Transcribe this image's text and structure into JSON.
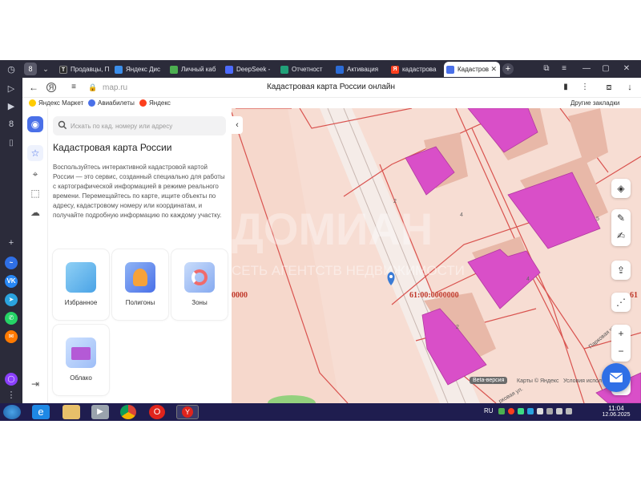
{
  "browser": {
    "tabs": [
      {
        "label": "Продавцы, П",
        "favicon": "T",
        "color": "#2b2b2b"
      },
      {
        "label": "Яндекс Дис",
        "favicon": "",
        "color": "#3b8eea"
      },
      {
        "label": "Личный каб",
        "favicon": "",
        "color": "#4caf50"
      },
      {
        "label": "DeepSeek -",
        "favicon": "",
        "color": "#4d6bfe"
      },
      {
        "label": "Отчетност",
        "favicon": "",
        "color": "#21a179"
      },
      {
        "label": "Активация",
        "favicon": "",
        "color": "#2c6cd6"
      },
      {
        "label": "кадастрова",
        "favicon": "Я",
        "color": "#fc3f1d"
      },
      {
        "label": "Кадастров",
        "favicon": "",
        "color": "#4a70e8",
        "active": true
      }
    ],
    "tab_count_badge": "8",
    "url": "map.ru",
    "page_title": "Кадастровая карта России онлайн",
    "bookmarks": [
      {
        "label": "Яндекс Маркет",
        "color": "#ffcc00"
      },
      {
        "label": "Авиабилеты",
        "color": "#4a70e8"
      },
      {
        "label": "Яндекс",
        "color": "#fc3f1d"
      }
    ],
    "other_bookmarks": "Другие закладки"
  },
  "panel": {
    "search_placeholder": "Искать по кад. номеру или адресу",
    "title": "Кадастровая карта России",
    "description": "Воспользуйтесь интерактивной кадастровой картой России — это сервис, созданный специально для работы с картографической информацией в режиме реального времени. Перемещайтесь по карте, ищите объекты по адресу, кадастровому номеру или координатам, и получайте подробную информацию по каждому участку.",
    "cards": [
      {
        "label": "Избранное"
      },
      {
        "label": "Полигоны"
      },
      {
        "label": "Зоны"
      },
      {
        "label": "Облако"
      }
    ]
  },
  "map": {
    "watermark_title": "ДОМИАН",
    "watermark_subtitle": "СЕТЬ АГЕНТСТВ НЕДВИЖИМОСТИ",
    "parcel_number_left": "0000",
    "parcel_number": "61:00:0000000",
    "parcel_number_right": "61",
    "plot_labels": [
      "2",
      "4",
      "2",
      "4",
      "5"
    ],
    "street_label": "Парковая ул.",
    "street_label_2": "рковая ул.",
    "beta": "Beta-версия",
    "attribution_maps": "Карты © Яндекс",
    "attribution_terms": "Условия испол",
    "colors": {
      "parcel_fill": "#f7ddd3",
      "parcel_line": "#d9534f",
      "building": "#d94fc8",
      "marker": "#3a7bd5"
    }
  },
  "taskbar": {
    "lang": "RU",
    "time": "11:04",
    "date": "12.06.2025"
  }
}
